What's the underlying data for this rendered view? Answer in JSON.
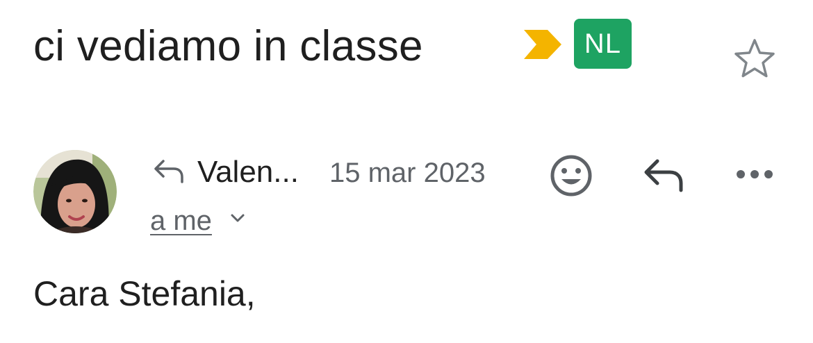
{
  "email": {
    "subject": "ci vediamo in classe",
    "label": "NL",
    "sender_name": "Valen...",
    "date": "15 mar 2023",
    "recipients": "a me",
    "body_first_line": "Cara Stefania,"
  },
  "icons": {
    "importance": "importance-marker-icon",
    "star": "star-outline-icon",
    "reply_indicator": "reply-arrow-icon",
    "emoji": "add-reaction-icon",
    "reply": "reply-icon",
    "more": "more-horizontal-icon",
    "expand": "chevron-down-icon"
  },
  "colors": {
    "importance": "#f4b400",
    "label_bg": "#1ea362",
    "secondary_text": "#5f6368",
    "icon_gray": "#5f6368",
    "primary_text": "#1f1f1f"
  }
}
